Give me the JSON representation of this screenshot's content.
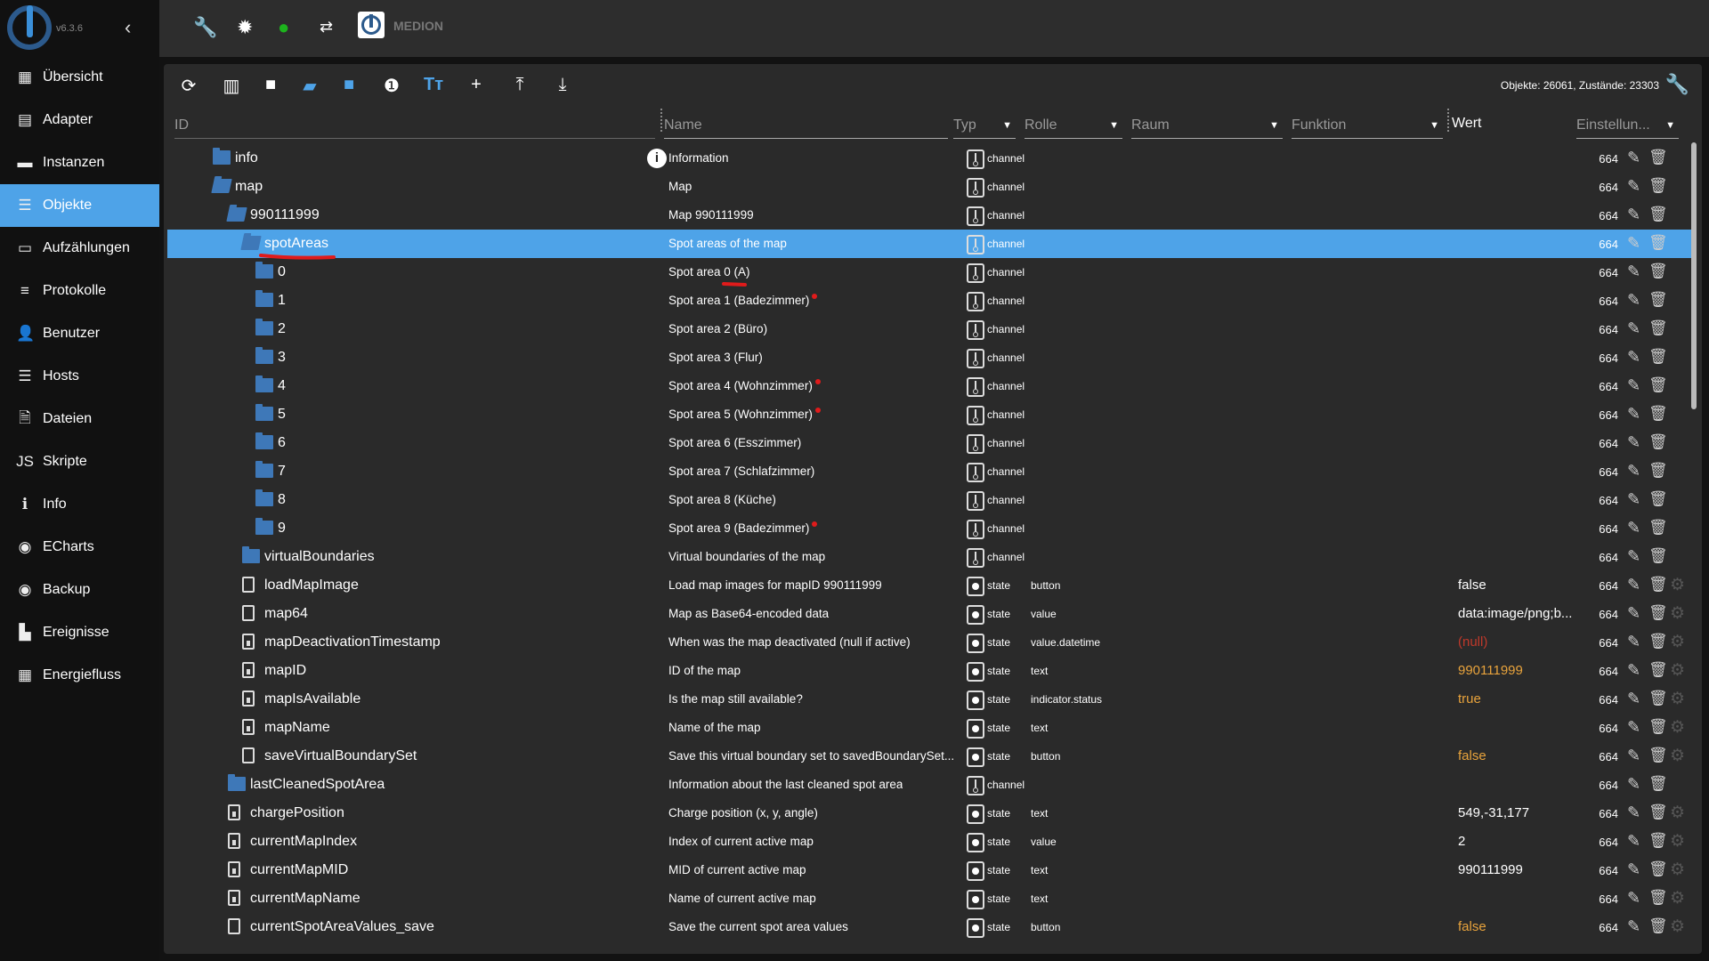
{
  "app": {
    "version": "v6.3.6",
    "host": "MEDION"
  },
  "sidebar": {
    "items": [
      {
        "label": "Übersicht",
        "icon": "grid-icon",
        "glyph": "▦"
      },
      {
        "label": "Adapter",
        "icon": "store-icon",
        "glyph": "▤"
      },
      {
        "label": "Instanzen",
        "icon": "instances-icon",
        "glyph": "▬"
      },
      {
        "label": "Objekte",
        "icon": "list-icon",
        "glyph": "☰",
        "selected": true
      },
      {
        "label": "Aufzählungen",
        "icon": "enum-icon",
        "glyph": "▭"
      },
      {
        "label": "Protokolle",
        "icon": "log-icon",
        "glyph": "≡"
      },
      {
        "label": "Benutzer",
        "icon": "user-icon",
        "glyph": "👤"
      },
      {
        "label": "Hosts",
        "icon": "hosts-icon",
        "glyph": "☰"
      },
      {
        "label": "Dateien",
        "icon": "files-icon",
        "glyph": "🗎"
      },
      {
        "label": "Skripte",
        "icon": "js-icon",
        "glyph": "JS"
      },
      {
        "label": "Info",
        "icon": "info-icon",
        "glyph": "ℹ"
      },
      {
        "label": "ECharts",
        "icon": "echarts-icon",
        "glyph": "◉"
      },
      {
        "label": "Backup",
        "icon": "backup-icon",
        "glyph": "◉"
      },
      {
        "label": "Ereignisse",
        "icon": "events-icon",
        "glyph": "▙"
      },
      {
        "label": "Energiefluss",
        "icon": "energy-icon",
        "glyph": "▦"
      }
    ]
  },
  "toolbar": {
    "counts": "Objekte: 26061, Zustände: 23303"
  },
  "columns": {
    "id": "ID",
    "name": "Name",
    "type": "Typ",
    "role": "Rolle",
    "room": "Raum",
    "function": "Funktion",
    "value": "Wert",
    "settings": "Einstellun..."
  },
  "colors": {
    "accent": "#4ea3e8",
    "value_orange": "#e8a33c",
    "value_null": "#c0392b",
    "annotation": "#e01b1b"
  },
  "rows": [
    {
      "id": "info",
      "level": 1,
      "icon": "folder",
      "name": "Information",
      "info": true,
      "type": "channel",
      "acl": "664"
    },
    {
      "id": "map",
      "level": 1,
      "icon": "folder-open",
      "name": "Map",
      "type": "channel",
      "acl": "664"
    },
    {
      "id": "990111999",
      "level": 2,
      "icon": "folder-open",
      "name": "Map 990111999",
      "type": "channel",
      "acl": "664"
    },
    {
      "id": "spotAreas",
      "level": 3,
      "icon": "folder-open",
      "name": "Spot areas of the map",
      "type": "channel",
      "acl": "664",
      "selected": true
    },
    {
      "id": "0",
      "level": 4,
      "icon": "folder",
      "name": "Spot area 0 (A)",
      "type": "channel",
      "acl": "664"
    },
    {
      "id": "1",
      "level": 4,
      "icon": "folder",
      "name": "Spot area 1 (Badezimmer)",
      "dot": true,
      "type": "channel",
      "acl": "664"
    },
    {
      "id": "2",
      "level": 4,
      "icon": "folder",
      "name": "Spot area 2 (Büro)",
      "type": "channel",
      "acl": "664"
    },
    {
      "id": "3",
      "level": 4,
      "icon": "folder",
      "name": "Spot area 3 (Flur)",
      "type": "channel",
      "acl": "664"
    },
    {
      "id": "4",
      "level": 4,
      "icon": "folder",
      "name": "Spot area 4 (Wohnzimmer)",
      "dot": true,
      "type": "channel",
      "acl": "664"
    },
    {
      "id": "5",
      "level": 4,
      "icon": "folder",
      "name": "Spot area 5 (Wohnzimmer)",
      "dot": true,
      "type": "channel",
      "acl": "664"
    },
    {
      "id": "6",
      "level": 4,
      "icon": "folder",
      "name": "Spot area 6 (Esszimmer)",
      "type": "channel",
      "acl": "664"
    },
    {
      "id": "7",
      "level": 4,
      "icon": "folder",
      "name": "Spot area 7 (Schlafzimmer)",
      "type": "channel",
      "acl": "664"
    },
    {
      "id": "8",
      "level": 4,
      "icon": "folder",
      "name": "Spot area 8 (Küche)",
      "type": "channel",
      "acl": "664"
    },
    {
      "id": "9",
      "level": 4,
      "icon": "folder",
      "name": "Spot area 9 (Badezimmer)",
      "dot": true,
      "type": "channel",
      "acl": "664"
    },
    {
      "id": "virtualBoundaries",
      "level": 3,
      "icon": "folder",
      "name": "Virtual boundaries of the map",
      "type": "channel",
      "acl": "664"
    },
    {
      "id": "loadMapImage",
      "level": 3,
      "icon": "file",
      "name": "Load map images for mapID 990111999",
      "type": "state",
      "role": "button",
      "value": "false",
      "valueColor": "white",
      "acl": "664",
      "gear": true
    },
    {
      "id": "map64",
      "level": 3,
      "icon": "file",
      "name": "Map as Base64-encoded data",
      "type": "state",
      "role": "value",
      "value": "data:image/png;b...",
      "valueColor": "white",
      "acl": "664",
      "gear": true
    },
    {
      "id": "mapDeactivationTimestamp",
      "level": 3,
      "icon": "file-lock",
      "name": "When was the map deactivated (null if active)",
      "type": "state",
      "role": "value.datetime",
      "value": "(null)",
      "valueColor": "null",
      "acl": "664",
      "gear": true
    },
    {
      "id": "mapID",
      "level": 3,
      "icon": "file-lock",
      "name": "ID of the map",
      "type": "state",
      "role": "text",
      "value": "990111999",
      "valueColor": "orange",
      "acl": "664",
      "gear": true
    },
    {
      "id": "mapIsAvailable",
      "level": 3,
      "icon": "file-lock",
      "name": "Is the map still available?",
      "type": "state",
      "role": "indicator.status",
      "value": "true",
      "valueColor": "orange",
      "acl": "664",
      "gear": true
    },
    {
      "id": "mapName",
      "level": 3,
      "icon": "file-lock",
      "name": "Name of the map",
      "type": "state",
      "role": "text",
      "acl": "664",
      "gear": true
    },
    {
      "id": "saveVirtualBoundarySet",
      "level": 3,
      "icon": "file",
      "name": "Save this virtual boundary set to savedBoundarySet...",
      "type": "state",
      "role": "button",
      "value": "false",
      "valueColor": "orange",
      "acl": "664",
      "gear": true
    },
    {
      "id": "lastCleanedSpotArea",
      "level": 2,
      "icon": "folder",
      "name": "Information about the last cleaned spot area",
      "type": "channel",
      "acl": "664"
    },
    {
      "id": "chargePosition",
      "level": 2,
      "icon": "file-lock",
      "name": "Charge position (x, y, angle)",
      "type": "state",
      "role": "text",
      "value": "549,-31,177",
      "valueColor": "white",
      "acl": "664",
      "gear": true
    },
    {
      "id": "currentMapIndex",
      "level": 2,
      "icon": "file-lock",
      "name": "Index of current active map",
      "type": "state",
      "role": "value",
      "value": "2",
      "valueColor": "white",
      "acl": "664",
      "gear": true
    },
    {
      "id": "currentMapMID",
      "level": 2,
      "icon": "file-lock",
      "name": "MID of current active map",
      "type": "state",
      "role": "text",
      "value": "990111999",
      "valueColor": "white",
      "acl": "664",
      "gear": true
    },
    {
      "id": "currentMapName",
      "level": 2,
      "icon": "file-lock",
      "name": "Name of current active map",
      "type": "state",
      "role": "text",
      "acl": "664",
      "gear": true
    },
    {
      "id": "currentSpotAreaValues_save",
      "level": 2,
      "icon": "file",
      "name": "Save the current spot area values",
      "type": "state",
      "role": "button",
      "value": "false",
      "valueColor": "orange",
      "acl": "664",
      "gear": true
    }
  ]
}
